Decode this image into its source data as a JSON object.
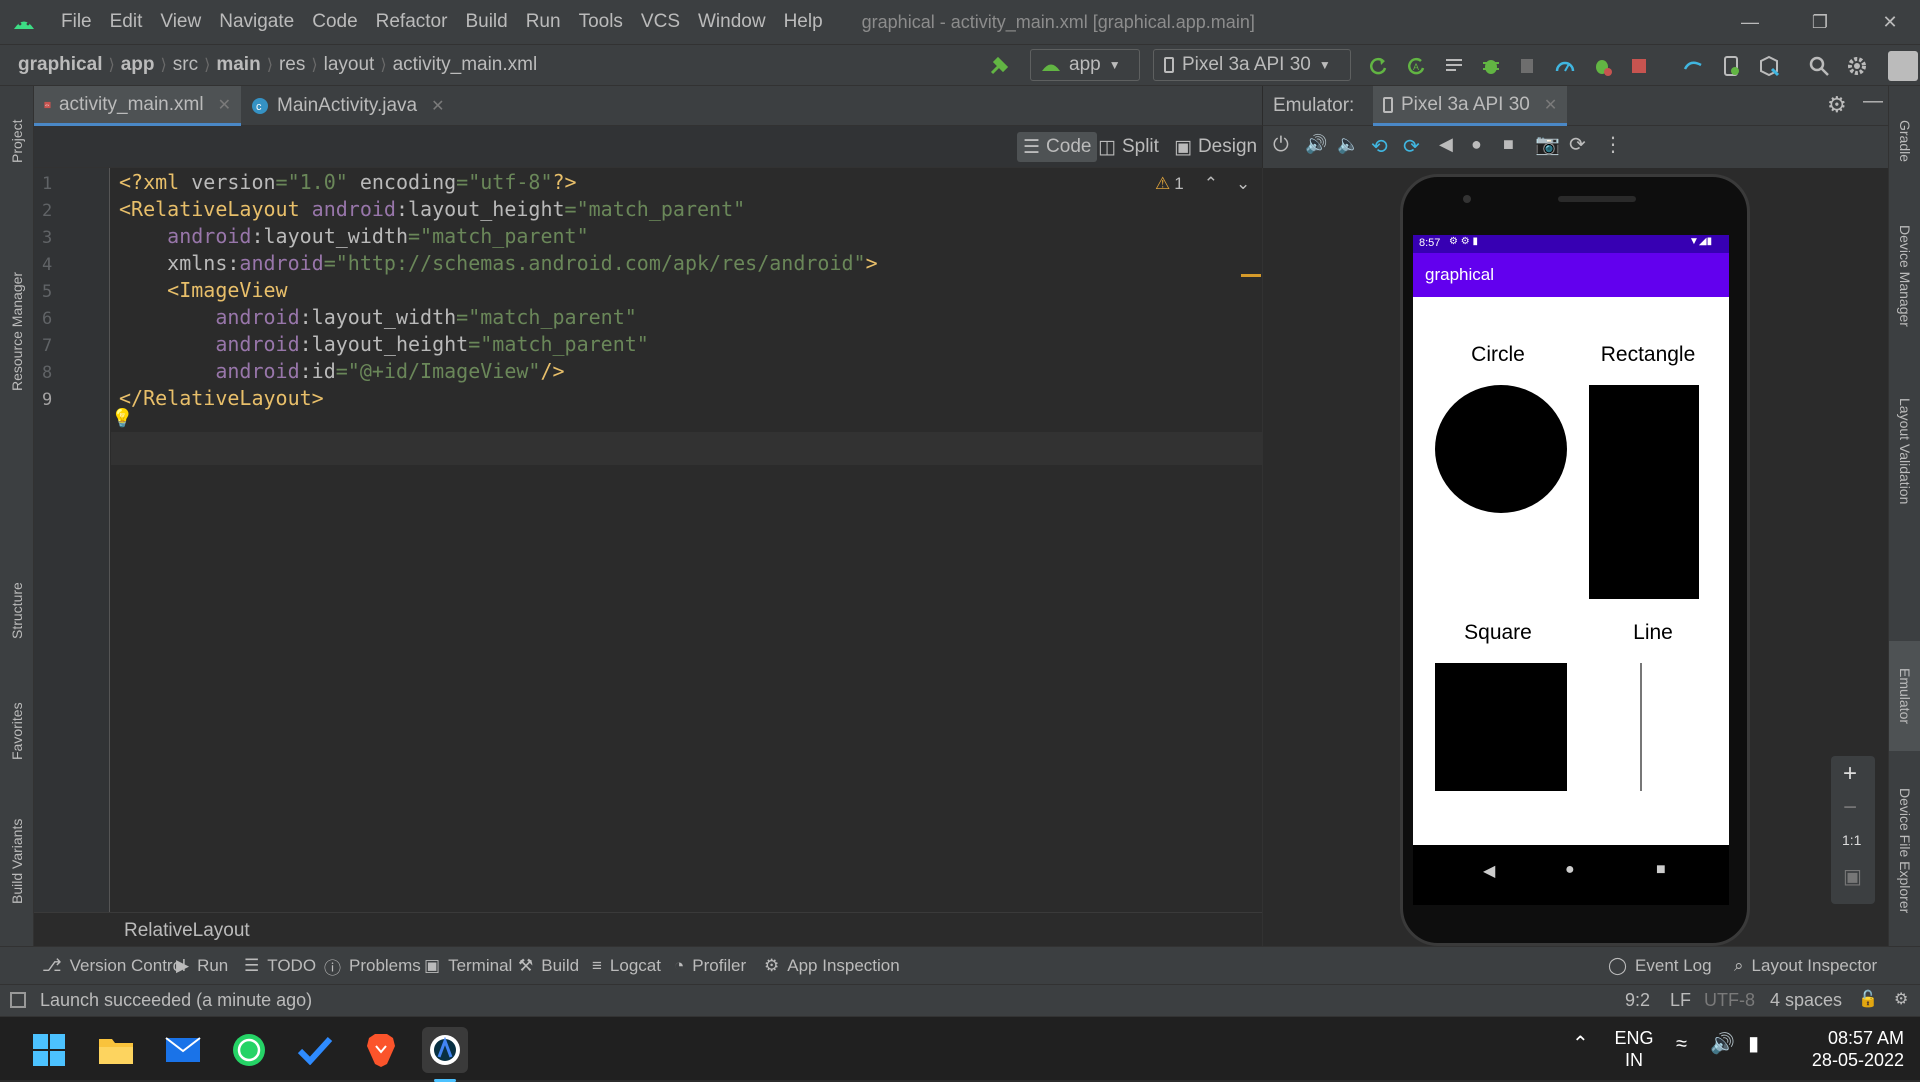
{
  "window": {
    "title": "graphical - activity_main.xml [graphical.app.main]",
    "menu": [
      "File",
      "Edit",
      "View",
      "Navigate",
      "Code",
      "Refactor",
      "Build",
      "Run",
      "Tools",
      "VCS",
      "Window",
      "Help"
    ]
  },
  "breadcrumb": [
    "graphical",
    "app",
    "src",
    "main",
    "res",
    "layout",
    "activity_main.xml"
  ],
  "toolbar": {
    "run_config": "app",
    "device": "Pixel 3a API 30"
  },
  "left_tabs": [
    "Project",
    "Resource Manager",
    "Structure",
    "Favorites",
    "Build Variants"
  ],
  "right_tabs": [
    "Gradle",
    "Device Manager",
    "Layout Validation",
    "Emulator",
    "Device File Explorer"
  ],
  "editor": {
    "tabs": [
      {
        "label": "activity_main.xml",
        "icon": "xml-file-icon"
      },
      {
        "label": "MainActivity.java",
        "icon": "java-class-icon"
      }
    ],
    "view_modes": [
      "Code",
      "Split",
      "Design"
    ],
    "warning_count": "1",
    "line_numbers": [
      "1",
      "2",
      "3",
      "4",
      "5",
      "6",
      "7",
      "8",
      "9"
    ],
    "lines": [
      [
        {
          "t": "<?xml ",
          "c": "decl"
        },
        {
          "t": "version",
          "c": "attr"
        },
        {
          "t": "=\"1.0\" ",
          "c": "val"
        },
        {
          "t": "encoding",
          "c": "attr"
        },
        {
          "t": "=\"utf-8\"",
          "c": "val"
        },
        {
          "t": "?>",
          "c": "decl"
        }
      ],
      [
        {
          "t": "<RelativeLayout ",
          "c": "tag"
        },
        {
          "t": "android",
          "c": "ns"
        },
        {
          "t": ":layout_height",
          "c": "attr"
        },
        {
          "t": "=\"match_parent\"",
          "c": "val"
        }
      ],
      [
        {
          "t": "    android",
          "c": "ns"
        },
        {
          "t": ":layout_width",
          "c": "attr"
        },
        {
          "t": "=\"match_parent\"",
          "c": "val"
        }
      ],
      [
        {
          "t": "    xmlns:",
          "c": "attr"
        },
        {
          "t": "android",
          "c": "ns"
        },
        {
          "t": "=\"http://schemas.android.com/apk/res/android\"",
          "c": "val"
        },
        {
          "t": ">",
          "c": "tag"
        }
      ],
      [
        {
          "t": "    <ImageView",
          "c": "tag"
        }
      ],
      [
        {
          "t": "        android",
          "c": "ns"
        },
        {
          "t": ":layout_width",
          "c": "attr"
        },
        {
          "t": "=\"match_parent\"",
          "c": "val"
        }
      ],
      [
        {
          "t": "        android",
          "c": "ns"
        },
        {
          "t": ":layout_height",
          "c": "attr"
        },
        {
          "t": "=\"match_parent\"",
          "c": "val"
        }
      ],
      [
        {
          "t": "        android",
          "c": "ns"
        },
        {
          "t": ":id",
          "c": "attr"
        },
        {
          "t": "=\"@+id/ImageView\"",
          "c": "val"
        },
        {
          "t": "/>",
          "c": "tag"
        }
      ],
      [
        {
          "t": "</RelativeLayout>",
          "c": "tag"
        }
      ]
    ],
    "breadcrumb_bottom": "RelativeLayout"
  },
  "emulator": {
    "label": "Emulator:",
    "device_tab": "Pixel 3a API 30",
    "status_time": "8:57",
    "app_title": "graphical",
    "shapes": [
      "Circle",
      "Rectangle",
      "Square",
      "Line"
    ],
    "zoom_label": "1:1"
  },
  "bottom_tabs": [
    "Version Control",
    "Run",
    "TODO",
    "Problems",
    "Terminal",
    "Build",
    "Logcat",
    "Profiler",
    "App Inspection"
  ],
  "bottom_tabs_right": [
    "Event Log",
    "Layout Inspector"
  ],
  "status": {
    "message": "Launch succeeded (a minute ago)",
    "position": "9:2",
    "line_sep": "LF",
    "encoding": "UTF-8",
    "indent": "4 spaces"
  },
  "taskbar": {
    "lang": "ENG",
    "region": "IN",
    "time": "08:57 AM",
    "date": "28-05-2022"
  },
  "colors": {
    "accent": "#4a88c7",
    "app_bar": "#6200ee",
    "status_bar": "#3700b3"
  }
}
